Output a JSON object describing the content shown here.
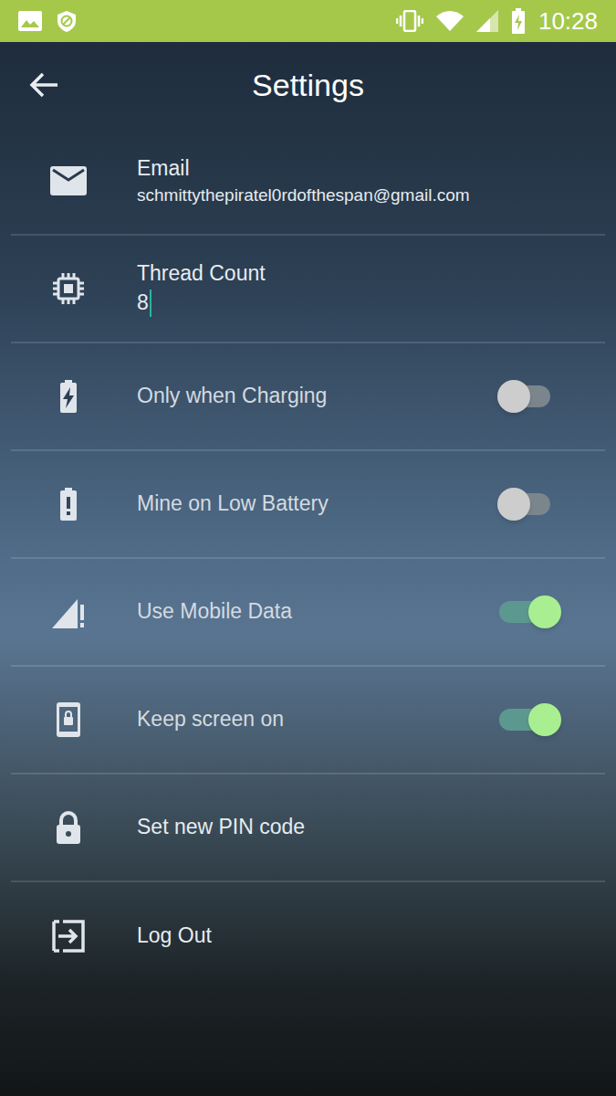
{
  "status_bar": {
    "time": "10:28"
  },
  "header": {
    "title": "Settings"
  },
  "settings": [
    {
      "kind": "field",
      "label": "Email",
      "value": "schmittythepiratel0rdofthespan@gmail.com",
      "focused": false
    },
    {
      "kind": "field",
      "label": "Thread Count",
      "value": "8",
      "focused": true
    },
    {
      "kind": "toggle",
      "label": "Only when Charging",
      "on": false
    },
    {
      "kind": "toggle",
      "label": "Mine on Low Battery",
      "on": false
    },
    {
      "kind": "toggle",
      "label": "Use Mobile Data",
      "on": true
    },
    {
      "kind": "toggle",
      "label": "Keep screen on",
      "on": true
    },
    {
      "kind": "action",
      "label": "Set new PIN code"
    },
    {
      "kind": "action",
      "label": "Log Out"
    }
  ]
}
